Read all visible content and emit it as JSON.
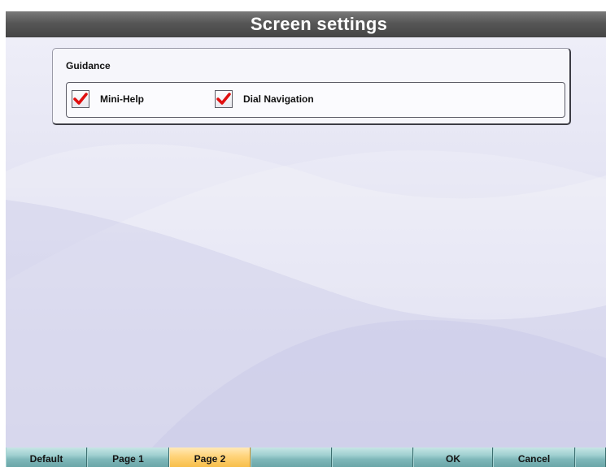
{
  "window": {
    "title": "Screen settings"
  },
  "guidance": {
    "group_label": "Guidance",
    "options": [
      {
        "label": "Mini-Help",
        "checked": true
      },
      {
        "label": "Dial Navigation",
        "checked": true
      }
    ]
  },
  "button_bar": {
    "buttons": [
      {
        "label": "Default",
        "active": false
      },
      {
        "label": "Page 1",
        "active": false
      },
      {
        "label": "Page 2",
        "active": true
      },
      {
        "label": "",
        "active": false
      },
      {
        "label": "",
        "active": false
      },
      {
        "label": "OK",
        "active": false
      },
      {
        "label": "Cancel",
        "active": false
      },
      {
        "label": "",
        "active": false
      }
    ]
  },
  "colors": {
    "title_bar": "#565656",
    "background": "#dcdcf0",
    "button_teal": "#8ec4c6",
    "button_active": "#f7c85e",
    "checkmark_red": "#e01010"
  },
  "icons": {
    "checkbox_mark": "red-checkmark-icon"
  }
}
